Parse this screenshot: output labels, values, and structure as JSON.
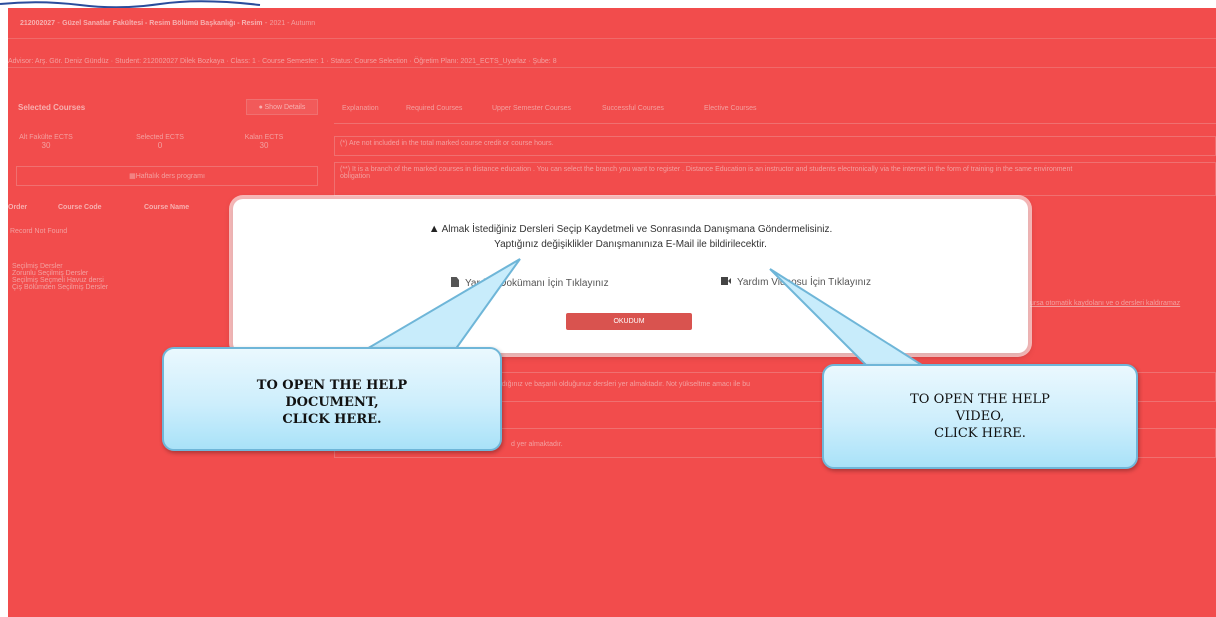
{
  "header": {
    "code": "212002027",
    "title": "Güzel Sanatlar Fakültesi - Resim Bölümü Başkanlığı - Resim",
    "term": "2021 - Autumn"
  },
  "info_bar": "Advisor: Arş. Gör. Deniz Gündüz · Student: 212002027 Dilek Bozkaya · Class: 1 · Course Semester: 1 · Status: Course Selection · Öğretim Planı: 2021_ECTS_Uyarlaz · Şube: 8",
  "left_panel": {
    "title": "Selected Courses",
    "show_details": "Show Details",
    "stats": [
      {
        "label": "Alt Fakülte ECTS",
        "value": "30"
      },
      {
        "label": "Selected ECTS",
        "value": "0"
      },
      {
        "label": "Kalan ECTS",
        "value": "30"
      }
    ],
    "weekly_program": "Haftalık ders programı",
    "columns": [
      "Order",
      "Course Code",
      "Course Name"
    ],
    "record_not_found": "Record Not Found",
    "legend": [
      "Seçilmiş Dersler",
      "Zorunlu Seçilmiş Dersler",
      "Seçilmiş Seçmeli Havuz dersi",
      "Çiş Bölümden Seçilmiş Dersler"
    ]
  },
  "tabs": [
    "Explanation",
    "Required Courses",
    "Upper Semester Courses",
    "Successful Courses",
    "Elective Courses"
  ],
  "notes": [
    "(*) Are not included in the total marked course credit or course hours.",
    "(**) It is a branch of the marked courses in distance education . You can select the branch you want to register . Distance Education is an instructor and students electronically via the internet in the form of training in the same environment",
    "obligation",
    "ce aldığınız ve başarılı olduğunuz dersleri yer almaktadır. Not yükseltme amacı ile bu",
    "d yer almaktadır."
  ],
  "side_link": "ursa otomatik kaydolanı ve o dersleri kaldıramaz",
  "modal": {
    "line1": "Almak İstediğiniz Dersleri Seçip Kaydetmeli ve Sonrasında Danışmana Göndermelisiniz.",
    "line2": "Yaptığınız değişiklikler Danışmanınıza E-Mail ile bildirilecektir.",
    "help_doc_label": "Yardım Dokümanı İçin Tıklayınız",
    "help_video_label": "Yardım Videosu İçin Tıklayınız",
    "ok_button": "OKUDUM"
  },
  "callouts": {
    "doc": [
      "TO OPEN THE HELP",
      "DOCUMENT,",
      "CLICK HERE."
    ],
    "video": [
      "TO OPEN THE HELP",
      "VIDEO,",
      "CLICK HERE."
    ]
  },
  "colors": {
    "overlay": "#f24c4c",
    "ok_button": "#d9534f",
    "callout_border": "#6fb6d8"
  }
}
